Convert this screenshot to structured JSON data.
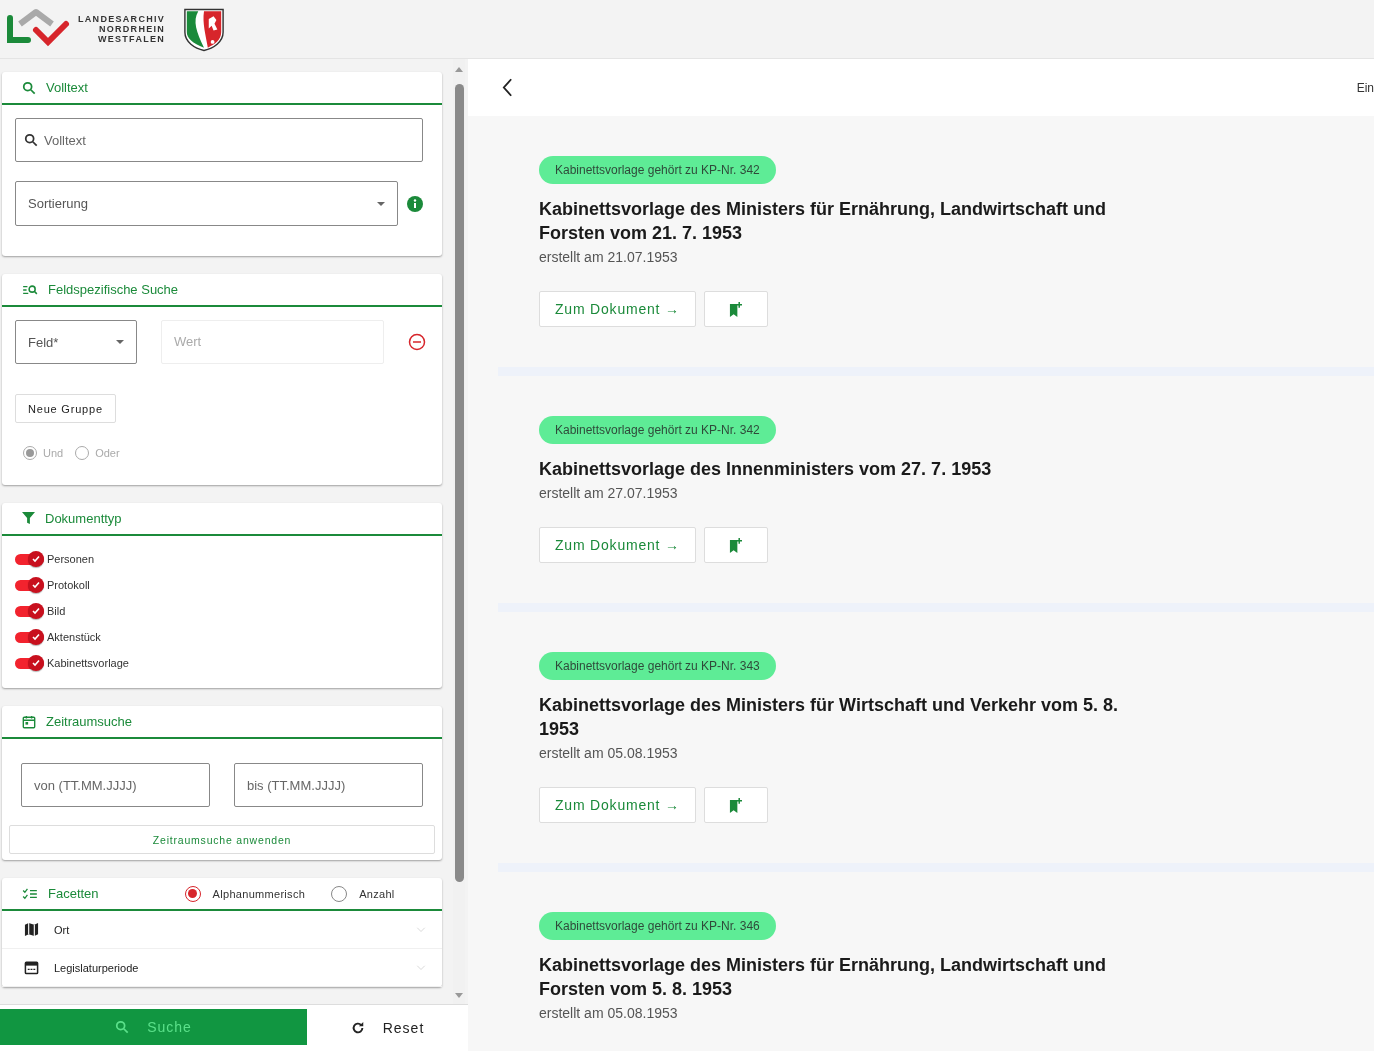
{
  "header": {
    "logo_lines": [
      "LANDESARCHIV",
      "NORDRHEIN",
      "WESTFALEN"
    ]
  },
  "sidebar": {
    "fulltext": {
      "title": "Volltext",
      "search_placeholder": "Volltext",
      "sort_placeholder": "Sortierung"
    },
    "field_search": {
      "title": "Feldspezifische Suche",
      "field_placeholder": "Feld*",
      "value_placeholder": "Wert",
      "new_group_button": "Neue Gruppe",
      "operators": [
        {
          "label": "Und",
          "selected": true,
          "disabled": true
        },
        {
          "label": "Oder",
          "selected": false,
          "disabled": true
        }
      ]
    },
    "document_types": {
      "title": "Dokumenttyp",
      "items": [
        {
          "label": "Personen",
          "checked": true
        },
        {
          "label": "Protokoll",
          "checked": true
        },
        {
          "label": "Bild",
          "checked": true
        },
        {
          "label": "Aktenstück",
          "checked": true
        },
        {
          "label": "Kabinettsvorlage",
          "checked": true
        }
      ]
    },
    "date_range": {
      "title": "Zeitraumsuche",
      "from_placeholder": "von (TT.MM.JJJJ)",
      "to_placeholder": "bis (TT.MM.JJJJ)",
      "apply_button": "Zeitraumsuche anwenden"
    },
    "facets": {
      "title": "Facetten",
      "sort_options": [
        {
          "label": "Alphanummerisch",
          "selected": true
        },
        {
          "label": "Anzahl",
          "selected": false
        }
      ],
      "items": [
        {
          "kind": "map",
          "label": "Ort"
        },
        {
          "kind": "calendar",
          "label": "Legislaturperiode"
        }
      ]
    }
  },
  "actions": {
    "search_button": "Suche",
    "reset_button": "Reset"
  },
  "topbar": {
    "right_text": "Ein"
  },
  "results": [
    {
      "badge": "Kabinettsvorlage gehört zu KP-Nr. 342",
      "title": "Kabinettsvorlage des Ministers für Ernährung, Landwirtschaft und Forsten vom 21. 7. 1953",
      "created": "erstellt am 21.07.1953",
      "open_button": "Zum Dokument →"
    },
    {
      "badge": "Kabinettsvorlage gehört zu KP-Nr. 342",
      "title": "Kabinettsvorlage des Innenministers vom 27. 7. 1953",
      "created": "erstellt am 27.07.1953",
      "open_button": "Zum Dokument →"
    },
    {
      "badge": "Kabinettsvorlage gehört zu KP-Nr. 343",
      "title": "Kabinettsvorlage des Ministers für Wirtschaft und Verkehr vom 5. 8. 1953",
      "created": "erstellt am 05.08.1953",
      "open_button": "Zum Dokument →"
    },
    {
      "badge": "Kabinettsvorlage gehört zu KP-Nr. 346",
      "title": "Kabinettsvorlage des Ministers für Ernährung, Landwirtschaft und Forsten vom 5. 8. 1953",
      "created": "erstellt am 05.08.1953"
    }
  ]
}
